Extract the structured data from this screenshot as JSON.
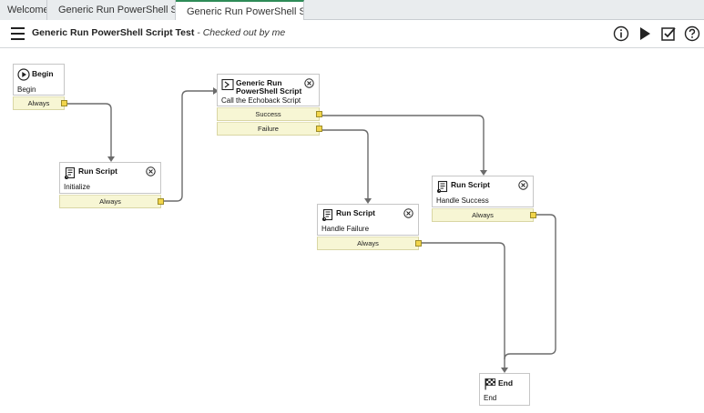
{
  "tabs": [
    {
      "label": "Welcome",
      "icon": "none"
    },
    {
      "label": "Generic Run PowerShell Sc...",
      "icon": "link-icon"
    },
    {
      "label": "Generic Run PowerShell Sc...",
      "icon": "workflow-icon"
    }
  ],
  "header": {
    "title": "Generic Run PowerShell Script Test",
    "subtitle": "- Checked out by me",
    "actions": [
      "info-icon",
      "run-icon",
      "checkin-icon",
      "help-icon"
    ]
  },
  "nodes": {
    "begin": {
      "title": "Begin",
      "desc": "Begin",
      "port": "Always"
    },
    "initialize": {
      "title": "Run Script",
      "desc": "Initialize",
      "port": "Always"
    },
    "powershell": {
      "title1": "Generic Run",
      "title2": "PowerShell Script",
      "desc": "Call the Echoback Script",
      "port_success": "Success",
      "port_failure": "Failure"
    },
    "handle_success": {
      "title": "Run Script",
      "desc": "Handle Success",
      "port": "Always"
    },
    "handle_failure": {
      "title": "Run Script",
      "desc": "Handle Failure",
      "port": "Always"
    },
    "end": {
      "title": "End",
      "desc": "End"
    }
  },
  "colors": {
    "accent": "#2e8b57",
    "port_bg": "#f7f6d4",
    "port_dot": "#f2d54b",
    "wire": "#6b6b6b"
  }
}
